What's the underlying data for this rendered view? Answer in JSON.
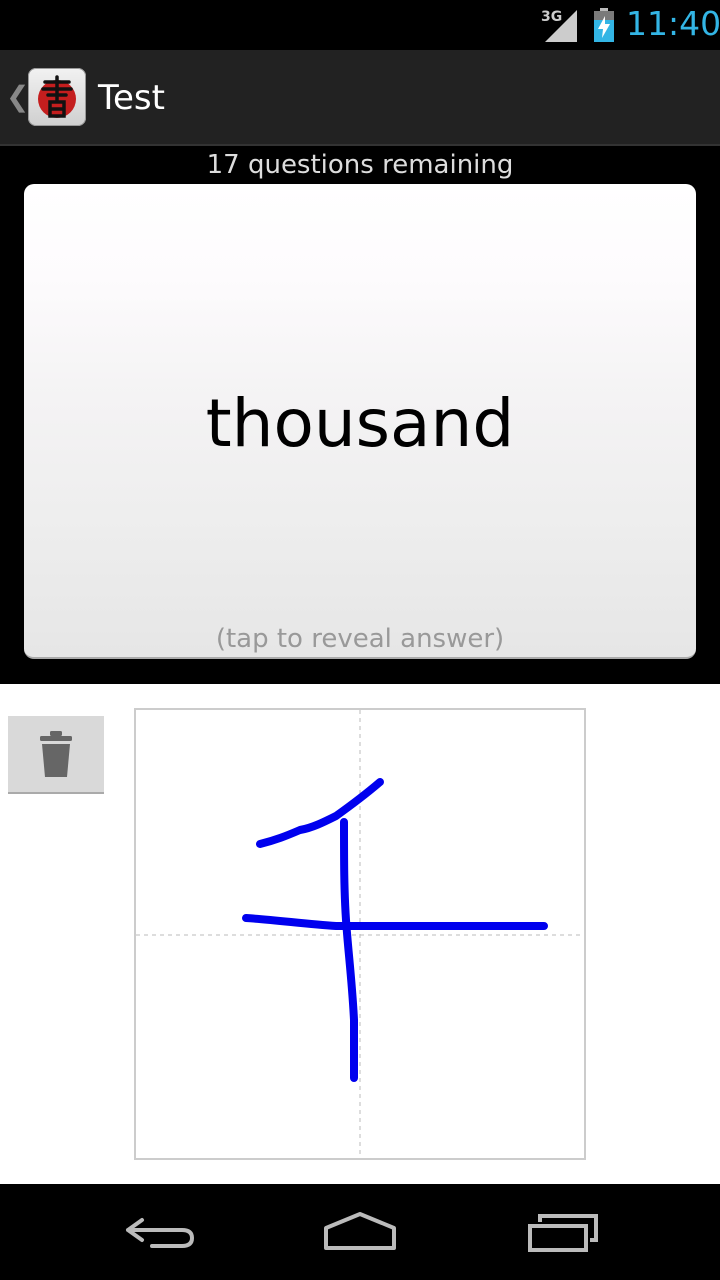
{
  "status_bar": {
    "network": "3G",
    "time": "11:40"
  },
  "action_bar": {
    "title": "Test",
    "up_caret": "❮"
  },
  "quiz": {
    "remaining": "17 questions remaining",
    "word": "thousand",
    "hint": "(tap to reveal answer)"
  },
  "icons": {
    "app": "calligraphy-app-icon",
    "clear": "trash-icon",
    "back": "back-icon",
    "home": "home-icon",
    "recents": "recents-icon"
  },
  "colors": {
    "clock": "#33b5e5",
    "stroke": "#0000ee",
    "card": "#ffffff"
  }
}
